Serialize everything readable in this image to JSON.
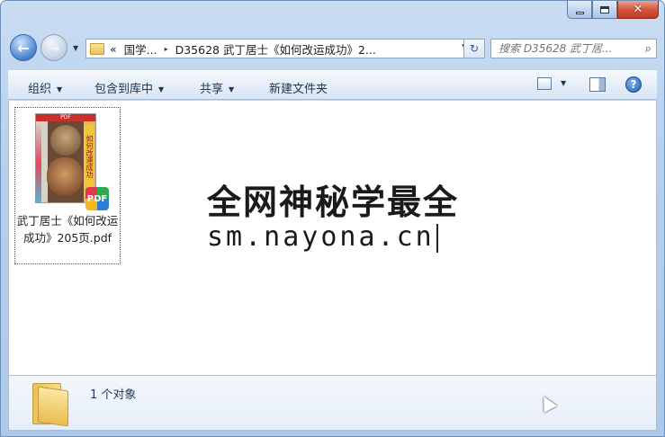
{
  "window": {
    "caption_buttons": [
      "minimize",
      "maximize",
      "close"
    ],
    "close_glyph": "✕"
  },
  "nav": {
    "back_glyph": "←",
    "forward_glyph": "→",
    "address": {
      "overflow": "«",
      "segment1": "国学...",
      "separator": "▸",
      "segment2": "D35628 武丁居士《如何改运成功》2..."
    },
    "refresh_glyph": "↻",
    "search_placeholder": "搜索 D35628 武丁居...",
    "search_icon": "search-icon"
  },
  "toolbar": {
    "organize": "组织",
    "include_in_library": "包含到库中",
    "share": "共享",
    "new_folder": "新建文件夹",
    "help": "?"
  },
  "files": [
    {
      "name": "武丁居士《如何改运成功》205页.pdf",
      "thumb_top": "PDF",
      "thumb_strip": "如何改運成功",
      "badge": "PDF"
    }
  ],
  "watermark": {
    "line1": "全网神秘学最全",
    "line2": "sm.nayona.cn"
  },
  "details": {
    "count_text": "1 个对象"
  },
  "colors": {
    "accent": "#1e3552",
    "chrome": "#b7cfec",
    "close": "#d4563e"
  }
}
